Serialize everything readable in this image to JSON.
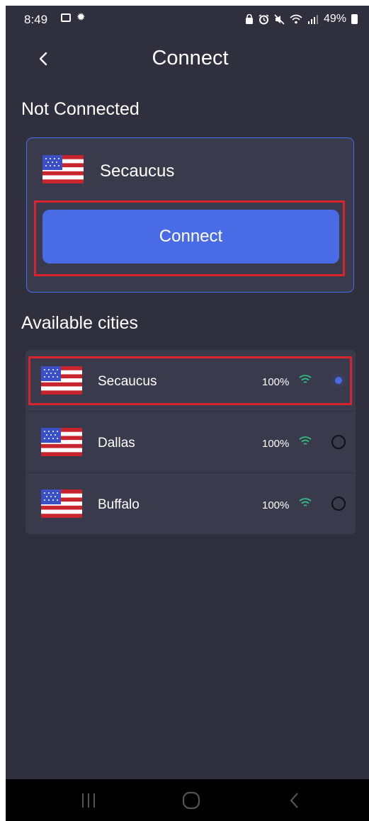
{
  "status_bar": {
    "time": "8:49",
    "battery": "49%",
    "icons": [
      "image-icon",
      "sun-icon",
      "lock-icon",
      "alarm-icon",
      "mute-icon",
      "wifi-icon",
      "signal-icon",
      "battery-icon"
    ]
  },
  "header": {
    "title": "Connect",
    "back_icon": "chevron-left-icon"
  },
  "status": {
    "label": "Not Connected"
  },
  "current_server": {
    "city": "Secaucus",
    "flag": "us-flag",
    "connect_label": "Connect"
  },
  "cities": {
    "heading": "Available cities",
    "items": [
      {
        "name": "Secaucus",
        "load": "100%",
        "selected": true
      },
      {
        "name": "Dallas",
        "load": "100%",
        "selected": false
      },
      {
        "name": "Buffalo",
        "load": "100%",
        "selected": false
      }
    ]
  },
  "colors": {
    "background": "#2f2f3e",
    "card": "#393a4c",
    "accent": "#4a6be6",
    "highlight": "#d9232d",
    "signal": "#2ec27e"
  },
  "nav": {
    "items": [
      "recent-apps-icon",
      "home-icon",
      "back-icon"
    ]
  }
}
